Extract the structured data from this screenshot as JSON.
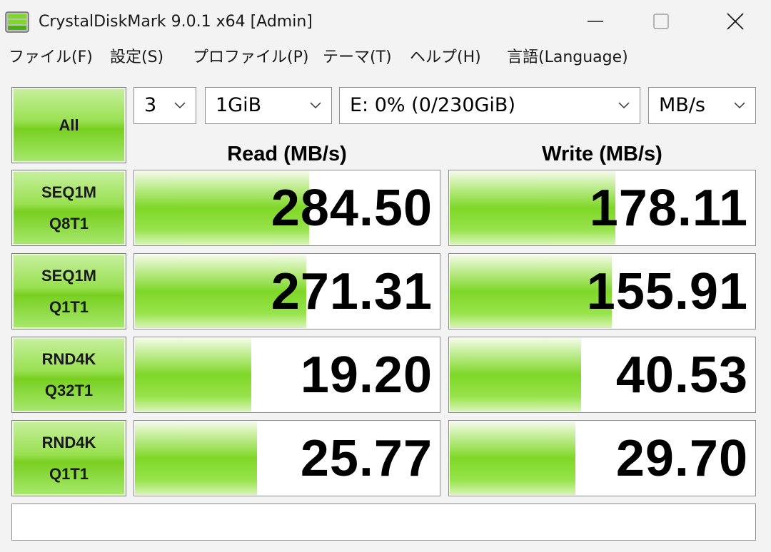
{
  "window": {
    "title": "CrystalDiskMark 9.0.1 x64 [Admin]"
  },
  "menu": {
    "items": [
      {
        "label": "ファイル(F)"
      },
      {
        "label": "設定(S)"
      },
      {
        "label": "プロファイル(P)"
      },
      {
        "label": "テーマ(T)"
      },
      {
        "label": "ヘルプ(H)"
      },
      {
        "label": "言語(Language)"
      }
    ]
  },
  "toolbar": {
    "all_label": "All",
    "count": "3",
    "size": "1GiB",
    "drive": "E: 0% (0/230GiB)",
    "unit": "MB/s"
  },
  "headers": {
    "read": "Read (MB/s)",
    "write": "Write (MB/s)"
  },
  "rows": [
    {
      "line1": "SEQ1M",
      "line2": "Q8T1",
      "read": "284.50",
      "write": "178.11",
      "read_level": 0.57,
      "write_level": 0.54
    },
    {
      "line1": "SEQ1M",
      "line2": "Q1T1",
      "read": "271.31",
      "write": "155.91",
      "read_level": 0.56,
      "write_level": 0.53
    },
    {
      "line1": "RND4K",
      "line2": "Q32T1",
      "read": "19.20",
      "write": "40.53",
      "read_level": 0.38,
      "write_level": 0.43
    },
    {
      "line1": "RND4K",
      "line2": "Q1T1",
      "read": "25.77",
      "write": "29.70",
      "read_level": 0.4,
      "write_level": 0.41
    }
  ],
  "comment": ""
}
